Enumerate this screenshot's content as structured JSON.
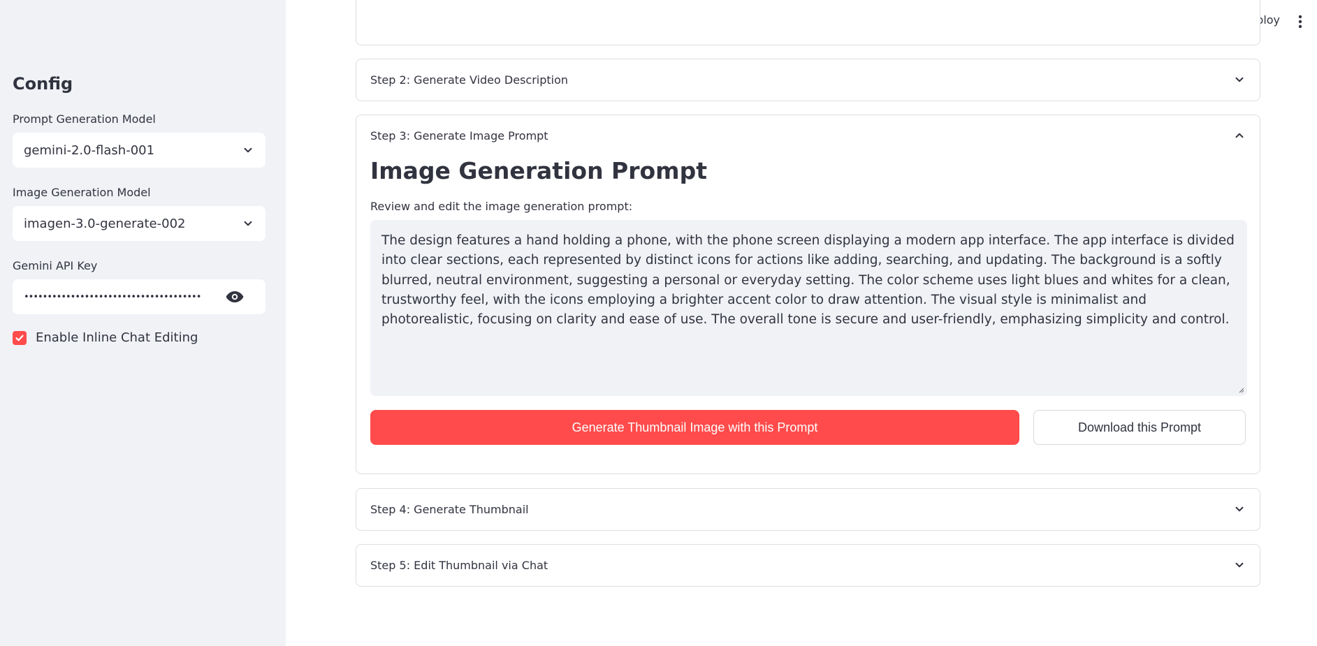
{
  "header": {
    "deploy_label": "Deploy",
    "menu_icon": "kebab-menu-icon"
  },
  "sidebar": {
    "title": "Config",
    "prompt_model": {
      "label": "Prompt Generation Model",
      "value": "gemini-2.0-flash-001"
    },
    "image_model": {
      "label": "Image Generation Model",
      "value": "imagen-3.0-generate-002"
    },
    "api_key": {
      "label": "Gemini API Key",
      "masked_value": "••••••••••••••••••••••••••••••••••••••"
    },
    "inline_chat": {
      "label": "Enable Inline Chat Editing",
      "checked": true
    }
  },
  "steps": [
    {
      "label": "Step 2: Generate Video Description",
      "expanded": false
    },
    {
      "label": "Step 3: Generate Image Prompt",
      "expanded": true
    },
    {
      "label": "Step 4: Generate Thumbnail",
      "expanded": false
    },
    {
      "label": "Step 5: Edit Thumbnail via Chat",
      "expanded": false
    }
  ],
  "step3": {
    "heading": "Image Generation Prompt",
    "textarea_label": "Review and edit the image generation prompt:",
    "prompt_text": "The design features a hand holding a phone, with the phone screen displaying a modern app interface. The app interface is divided into clear sections, each represented by distinct icons for actions like adding, searching, and updating. The background is a softly blurred, neutral environment, suggesting a personal or everyday setting. The color scheme uses light blues and whites for a clean, trustworthy feel, with the icons employing a brighter accent color to draw attention. The visual style is minimalist and photorealistic, focusing on clarity and ease of use. The overall tone is secure and user-friendly, emphasizing simplicity and control.",
    "generate_button": "Generate Thumbnail Image with this Prompt",
    "download_button": "Download this Prompt"
  },
  "colors": {
    "accent": "#ff4b4b",
    "sidebar_bg": "#f0f2f6",
    "text": "#31333f",
    "border": "#dcdee4"
  }
}
